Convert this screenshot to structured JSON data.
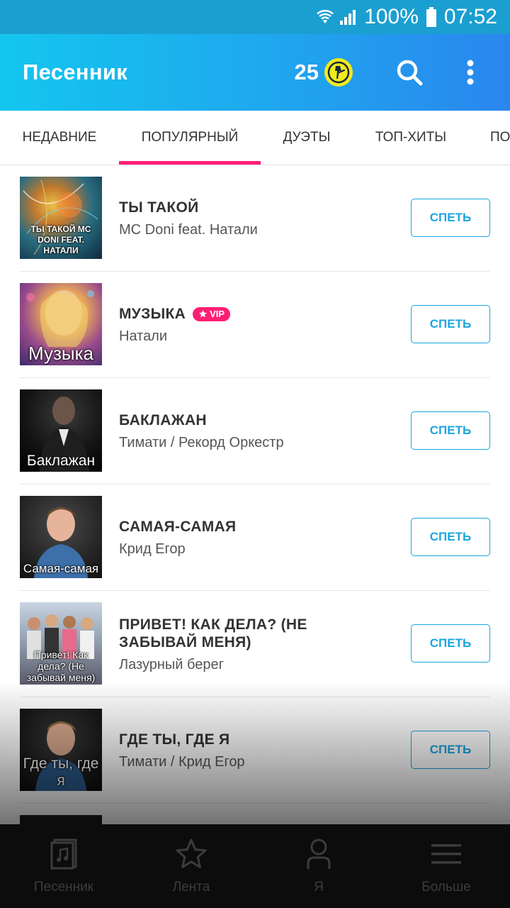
{
  "status_bar": {
    "battery": "100%",
    "time": "07:52",
    "icons": [
      "wifi-icon",
      "signal-icon",
      "battery-icon"
    ]
  },
  "header": {
    "title": "Песенник",
    "coins": "25",
    "coin_icon": "microphone-coin-icon",
    "search_icon": "search-icon",
    "menu_icon": "more-vertical-icon"
  },
  "tabs": [
    {
      "label": "НЕДАВНИЕ",
      "active": false
    },
    {
      "label": "ПОПУЛЯРНЫЙ",
      "active": true
    },
    {
      "label": "ДУЭТЫ",
      "active": false
    },
    {
      "label": "ТОП-ХИТЫ",
      "active": false
    },
    {
      "label": "ПО",
      "active": false
    }
  ],
  "songs": [
    {
      "title": "ТЫ ТАКОЙ",
      "artist": "MC Doni feat. Натали",
      "cover_text": "ТЫ ТАКОЙ MC DONI FEAT. НАТАЛИ",
      "vip": false,
      "button": "СПЕТЬ"
    },
    {
      "title": "МУЗЫКА",
      "artist": "Натали",
      "cover_text": "Музыка",
      "vip": true,
      "vip_label": "VIP",
      "button": "СПЕТЬ"
    },
    {
      "title": "БАКЛАЖАН",
      "artist": "Тимати / Рекорд Оркестр",
      "cover_text": "Баклажан",
      "vip": false,
      "button": "СПЕТЬ"
    },
    {
      "title": "САМАЯ-САМАЯ",
      "artist": "Крид Егор",
      "cover_text": "Самая-самая",
      "vip": false,
      "button": "СПЕТЬ"
    },
    {
      "title": "ПРИВЕТ! КАК ДЕЛА? (НЕ ЗАБЫВАЙ МЕНЯ)",
      "artist": "Лазурный берег",
      "cover_text": "Привет! Как дела? (Не забывай меня)",
      "vip": false,
      "button": "СПЕТЬ"
    },
    {
      "title": "ГДЕ ТЫ, ГДЕ Я",
      "artist": "Тимати / Крид Егор",
      "cover_text": "Где ты, где я",
      "vip": false,
      "button": "СПЕТЬ"
    }
  ],
  "bottom_nav": [
    {
      "label": "Песенник",
      "icon": "songbook-icon"
    },
    {
      "label": "Лента",
      "icon": "star-icon"
    },
    {
      "label": "Я",
      "icon": "profile-icon"
    },
    {
      "label": "Больше",
      "icon": "menu-icon"
    }
  ],
  "colors": {
    "accent": "#1aa6e0",
    "tab_indicator": "#ff1e74",
    "vip": "#ff1e74",
    "coin": "#f2ea1c"
  }
}
